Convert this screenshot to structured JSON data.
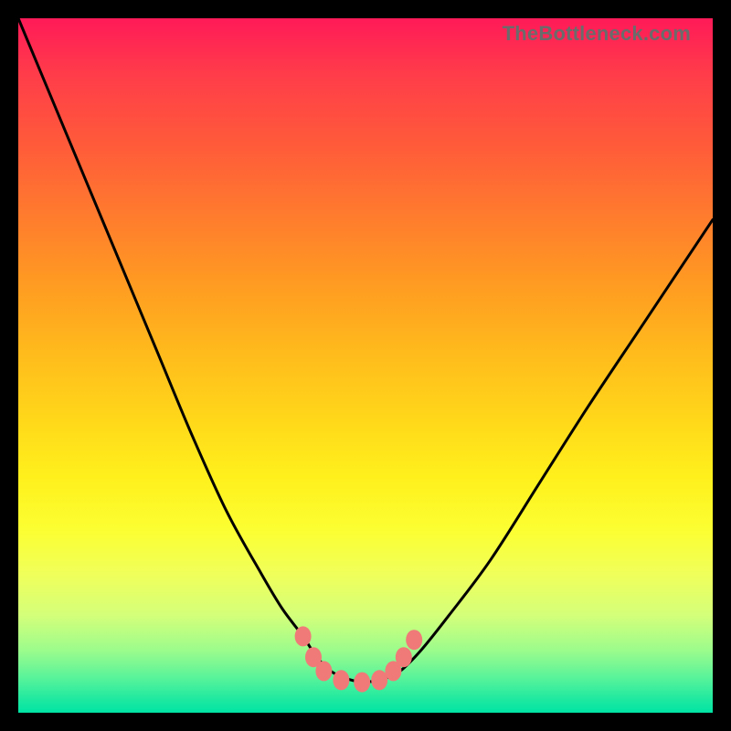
{
  "watermark": "TheBottleneck.com",
  "colors": {
    "frame": "#000000",
    "curve": "#000000",
    "marker": "#f07a78",
    "gradient_top": "#ff1a58",
    "gradient_bottom": "#00e4a4"
  },
  "chart_data": {
    "type": "line",
    "title": "",
    "xlabel": "",
    "ylabel": "",
    "xlim": [
      0,
      100
    ],
    "ylim": [
      0,
      100
    ],
    "note": "Axes are unlabeled in the source image; values are normalized 0–100 estimates read from pixel positions. y=0 is the top of the plot, y=100 is the bottom (green) edge.",
    "series": [
      {
        "name": "bottleneck-curve",
        "x": [
          0,
          5,
          10,
          15,
          20,
          25,
          30,
          35,
          38,
          41,
          43,
          45,
          47,
          49,
          51,
          53,
          55,
          58,
          62,
          68,
          75,
          82,
          90,
          100
        ],
        "y": [
          0,
          12,
          24,
          36,
          48,
          60,
          71,
          80,
          85,
          89,
          92,
          94,
          95,
          95.5,
          95.5,
          95,
          94,
          91,
          86,
          78,
          67,
          56,
          44,
          29
        ]
      }
    ],
    "markers": {
      "name": "highlight-points",
      "x": [
        41,
        42.5,
        44,
        46.5,
        49.5,
        52,
        54,
        55.5,
        57
      ],
      "y": [
        89,
        92,
        94,
        95.3,
        95.6,
        95.3,
        94,
        92,
        89.5
      ]
    }
  }
}
